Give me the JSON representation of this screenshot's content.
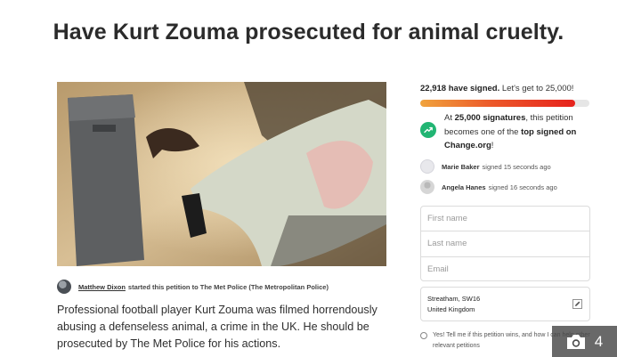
{
  "page": {
    "title": "Have Kurt Zouma prosecuted for animal cruelty."
  },
  "starter": {
    "name": "Matthew Dixon",
    "rest": "started this petition to The Met Police (The Metropolitan Police)"
  },
  "description": "Professional football player Kurt Zouma was filmed horrendously abusing a defenseless animal, a crime in the UK. He should be prosecuted by The Met Police for his actions.",
  "progress": {
    "signed_count": "22,918 have signed.",
    "goal_text": "Let's get to 25,000!",
    "fraction": 0.9167,
    "colors": {
      "start": "#f0a33d",
      "end": "#e6221c"
    }
  },
  "milestone": {
    "pre": "At",
    "strong1": "25,000 signatures",
    "mid": ", this petition becomes one of the",
    "strong2": "top signed on Change.org",
    "post": "!",
    "icon": "trending-up-icon",
    "icon_color": "#21b573"
  },
  "recent_signers": [
    {
      "name": "Marie Baker",
      "text": "signed 15 seconds ago"
    },
    {
      "name": "Angela Hanes",
      "text": "signed 16 seconds ago"
    }
  ],
  "form": {
    "first_name_placeholder": "First name",
    "last_name_placeholder": "Last name",
    "email_placeholder": "Email",
    "location_line1": "Streatham, SW16",
    "location_line2": "United Kingdom",
    "optin_text": "Yes! Tell me if this petition wins, and how I can help other relevant petitions"
  },
  "gallery": {
    "count": "4",
    "icon": "camera-icon"
  }
}
